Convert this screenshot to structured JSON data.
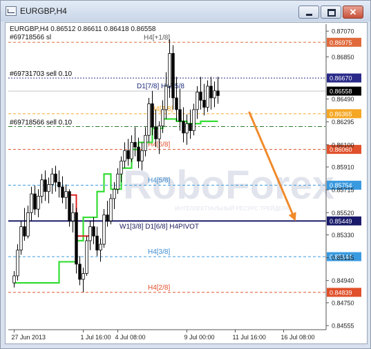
{
  "window": {
    "title": "EURGBP,H4",
    "buttons": [
      "minimize",
      "maximize",
      "close"
    ]
  },
  "chart_header": {
    "line1": "EURGBP,H4  0.86512 0.86611 0.86418 0.86558",
    "line2": "#69718566 sl"
  },
  "watermark": {
    "brand": "RoboForex",
    "tagline": "ИНТЕЛЛЕКТУАЛЬНЫЙ РЕСУРС ТРЕЙДЕРА"
  },
  "chart_data": {
    "type": "candlestick",
    "symbol": "EURGBP",
    "timeframe": "H4",
    "ylim": [
      0.8452,
      0.8713
    ],
    "y_ticks": [
      "0.87070",
      "0.86850",
      "0.86490",
      "0.86295",
      "0.86100",
      "0.85910",
      "0.85715",
      "0.85520",
      "0.85330",
      "0.85135",
      "0.84940",
      "0.84750",
      "0.84555"
    ],
    "x_ticks": [
      "27 Jun 2013",
      "1 Jul 16:00",
      "4 Jul 08:00",
      "9 Jul 00:00",
      "11 Jul 16:00",
      "16 Jul 08:00"
    ],
    "x_tick_bar": [
      0,
      20,
      30,
      50,
      64,
      78
    ],
    "price_levels": [
      {
        "value": 0.86975,
        "label": "0.86975",
        "color": "#e06a3c",
        "style": "dashed",
        "text": "H4[+1/8]",
        "text_color": "#555555"
      },
      {
        "value": 0.8667,
        "label": "0.86670",
        "color": "#2a2a8a",
        "style": "dotted",
        "text": "#69731703 sell 0.10",
        "text_color": "#000000"
      },
      {
        "value": 0.86558,
        "label": "0.86558",
        "color": "#000000",
        "style": "current",
        "text": "D1[7/8] H4R5/8",
        "text_color": "#1a2a7a"
      },
      {
        "value": 0.86365,
        "label": "0.86365",
        "color": "#f5a623",
        "style": "dashed",
        "text": "H4[7/8]",
        "text_color": "#f5a623"
      },
      {
        "value": 0.86255,
        "label": "",
        "color": "#2a7a2a",
        "style": "dashdot",
        "text": "#69718566 sell 0.10",
        "text_color": "#000000"
      },
      {
        "value": 0.8606,
        "label": "0.86060",
        "color": "#e0502a",
        "style": "dashed",
        "text": "H4[6/8]",
        "text_color": "#e0502a"
      },
      {
        "value": 0.85754,
        "label": "0.85754",
        "color": "#3a9ae0",
        "style": "dashed",
        "text": "H4[5/8]",
        "text_color": "#3a8ad0"
      },
      {
        "value": 0.85449,
        "label": "0.85449",
        "color": "#1a1a6a",
        "style": "solid",
        "text": "W1[3/8] D1[6/8] H4PIVOT",
        "text_color": "#1a1a5a"
      },
      {
        "value": 0.85144,
        "label": "0.85144",
        "color": "#3a9ae0",
        "style": "dashed",
        "text": "H4[3/8]",
        "text_color": "#3a8ad0"
      },
      {
        "value": 0.84839,
        "label": "0.84839",
        "color": "#e0502a",
        "style": "dashed",
        "text": "H4[2/8]",
        "text_color": "#e0502a"
      }
    ],
    "colors": {
      "candle_up": "#ffffff",
      "candle_down": "#000000",
      "wick": "#000000",
      "stop_line_up": "#33dd33",
      "stop_line_down": "#dd2222",
      "forecast_arrow": "#f08a2a",
      "watermark": "#d9dde6",
      "axis_text": "#222222",
      "grid": "#e8e8ee"
    },
    "candles": [
      [
        0.8492,
        0.8502,
        0.8488,
        0.8498
      ],
      [
        0.8498,
        0.8525,
        0.8494,
        0.852
      ],
      [
        0.852,
        0.8545,
        0.8516,
        0.854
      ],
      [
        0.854,
        0.8556,
        0.8528,
        0.8532
      ],
      [
        0.8532,
        0.8558,
        0.853,
        0.8552
      ],
      [
        0.8552,
        0.8574,
        0.8545,
        0.8568
      ],
      [
        0.8568,
        0.8575,
        0.855,
        0.8555
      ],
      [
        0.8555,
        0.8572,
        0.8548,
        0.8566
      ],
      [
        0.8566,
        0.8585,
        0.856,
        0.858
      ],
      [
        0.858,
        0.8588,
        0.8562,
        0.857
      ],
      [
        0.857,
        0.8582,
        0.856,
        0.8576
      ],
      [
        0.8576,
        0.859,
        0.8568,
        0.8585
      ],
      [
        0.8585,
        0.8592,
        0.857,
        0.8578
      ],
      [
        0.8578,
        0.8588,
        0.8565,
        0.8574
      ],
      [
        0.8574,
        0.8583,
        0.856,
        0.8565
      ],
      [
        0.8565,
        0.8576,
        0.8555,
        0.857
      ],
      [
        0.857,
        0.8572,
        0.854,
        0.8545
      ],
      [
        0.8545,
        0.856,
        0.8535,
        0.8552
      ],
      [
        0.8552,
        0.8556,
        0.85,
        0.8508
      ],
      [
        0.8508,
        0.8515,
        0.849,
        0.8495
      ],
      [
        0.8495,
        0.8505,
        0.8484,
        0.85
      ],
      [
        0.85,
        0.8532,
        0.8498,
        0.8528
      ],
      [
        0.8528,
        0.8545,
        0.852,
        0.854
      ],
      [
        0.854,
        0.8548,
        0.8525,
        0.8532
      ],
      [
        0.8532,
        0.854,
        0.8515,
        0.852
      ],
      [
        0.852,
        0.853,
        0.851,
        0.8525
      ],
      [
        0.8525,
        0.8555,
        0.8522,
        0.855
      ],
      [
        0.855,
        0.8562,
        0.854,
        0.8545
      ],
      [
        0.8545,
        0.8568,
        0.8542,
        0.8564
      ],
      [
        0.8564,
        0.8578,
        0.8555,
        0.8572
      ],
      [
        0.8572,
        0.859,
        0.8568,
        0.8585
      ],
      [
        0.8585,
        0.86,
        0.8578,
        0.8596
      ],
      [
        0.8596,
        0.8612,
        0.859,
        0.8605
      ],
      [
        0.8605,
        0.8615,
        0.8592,
        0.8598
      ],
      [
        0.8598,
        0.8618,
        0.8595,
        0.8612
      ],
      [
        0.8612,
        0.8625,
        0.86,
        0.8608
      ],
      [
        0.8608,
        0.8616,
        0.859,
        0.8596
      ],
      [
        0.8596,
        0.8612,
        0.8588,
        0.8605
      ],
      [
        0.8605,
        0.8625,
        0.86,
        0.8618
      ],
      [
        0.8618,
        0.865,
        0.8612,
        0.8645
      ],
      [
        0.8645,
        0.8656,
        0.8618,
        0.8625
      ],
      [
        0.8625,
        0.864,
        0.8608,
        0.8615
      ],
      [
        0.8615,
        0.863,
        0.8602,
        0.8626
      ],
      [
        0.8626,
        0.8648,
        0.862,
        0.864
      ],
      [
        0.864,
        0.8672,
        0.8632,
        0.866
      ],
      [
        0.866,
        0.87,
        0.865,
        0.8688
      ],
      [
        0.8688,
        0.8695,
        0.864,
        0.865
      ],
      [
        0.865,
        0.8668,
        0.863,
        0.864
      ],
      [
        0.864,
        0.8658,
        0.8622,
        0.863
      ],
      [
        0.863,
        0.8642,
        0.8612,
        0.862
      ],
      [
        0.862,
        0.8636,
        0.861,
        0.8628
      ],
      [
        0.8628,
        0.864,
        0.8615,
        0.8622
      ],
      [
        0.8622,
        0.8645,
        0.8618,
        0.864
      ],
      [
        0.864,
        0.866,
        0.8632,
        0.8655
      ],
      [
        0.8655,
        0.8668,
        0.864,
        0.8648
      ],
      [
        0.8648,
        0.8662,
        0.8635,
        0.8642
      ],
      [
        0.8642,
        0.8665,
        0.8638,
        0.866
      ],
      [
        0.866,
        0.8668,
        0.864,
        0.865
      ],
      [
        0.865,
        0.8664,
        0.8642,
        0.8656
      ],
      [
        0.8656,
        0.8668,
        0.8645,
        0.8652
      ]
    ],
    "up_stop_steps": [
      [
        0,
        13,
        0.8492
      ],
      [
        13,
        18,
        0.851
      ],
      [
        18,
        20,
        0.8528
      ],
      [
        20,
        24,
        0.8548
      ],
      [
        24,
        26,
        0.857
      ],
      [
        26,
        28,
        0.8585
      ],
      [
        28,
        31,
        0.8572
      ],
      [
        31,
        34,
        0.859
      ],
      [
        34,
        36,
        0.8606
      ],
      [
        36,
        40,
        0.8612
      ],
      [
        40,
        43,
        0.8624
      ],
      [
        43,
        47,
        0.8632
      ],
      [
        47,
        50,
        0.863
      ],
      [
        50,
        54,
        0.8628
      ],
      [
        54,
        59,
        0.863
      ]
    ],
    "forecast_arrow_from": [
      0.865,
      60
    ],
    "forecast_arrow_to": [
      0.8548,
      68
    ]
  }
}
